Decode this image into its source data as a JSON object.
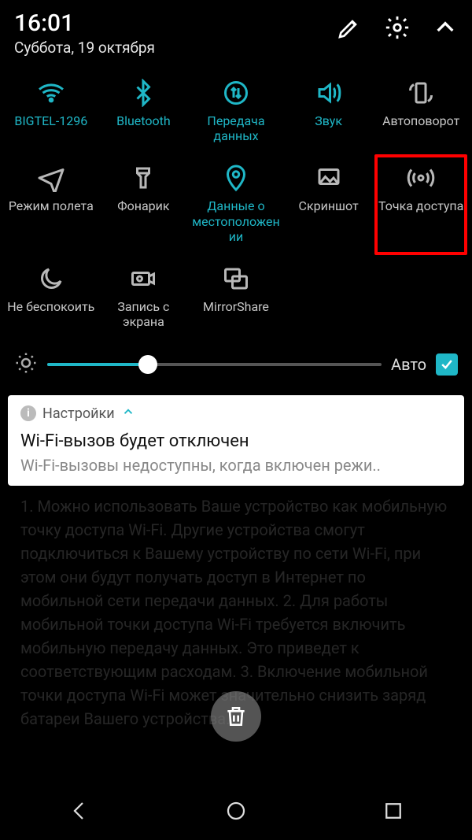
{
  "status": {
    "time": "16:01",
    "date": "Суббота, 19 октября"
  },
  "tiles": [
    {
      "label": "BIGTEL-1296",
      "active": true
    },
    {
      "label": "Bluetooth",
      "active": true
    },
    {
      "label": "Передача данных",
      "active": true
    },
    {
      "label": "Звук",
      "active": true
    },
    {
      "label": "Автоповорот",
      "active": false
    },
    {
      "label": "Режим полета",
      "active": false
    },
    {
      "label": "Фонарик",
      "active": false
    },
    {
      "label": "Данные о местоположении",
      "active": true
    },
    {
      "label": "Скриншот",
      "active": false
    },
    {
      "label": "Точка доступа",
      "active": false,
      "highlight": true
    },
    {
      "label": "Не беспокоить",
      "active": false
    },
    {
      "label": "Запись с экрана",
      "active": false
    },
    {
      "label": "MirrorShare",
      "active": false
    }
  ],
  "brightness": {
    "auto_label": "Авто",
    "auto_checked": true,
    "value_pct": 30
  },
  "notification": {
    "app": "Настройки",
    "title": "Wi-Fi-вызов будет отключен",
    "body": "Wi-Fi-вызовы недоступны, когда включен режи.."
  },
  "background_text": "1. Можно использовать Ваше устройство как мобильную точку доступа Wi-Fi. Другие устройства смогут подключиться к Вашему устройству по сети Wi-Fi, при этом они будут получать доступ в Интернет по мобильной сети передачи данных.\n2. Для работы мобильной точки доступа Wi-Fi требуется включить мобильную передачу данных. Это приведет к соответствующим расходам.\n3. Включение мобильной точки доступа Wi-Fi может значительно снизить заряд батареи Вашего устройства."
}
